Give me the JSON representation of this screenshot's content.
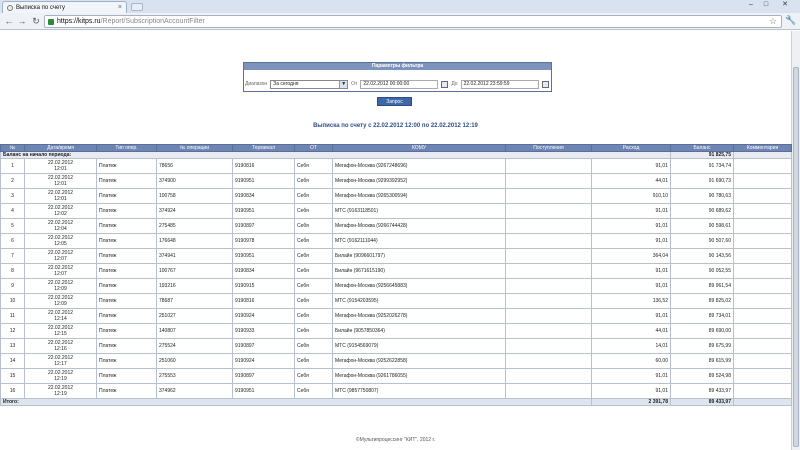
{
  "browser": {
    "tab_title": "Выписка по счету",
    "tab_close": "×",
    "win_min": "–",
    "win_max": "□",
    "win_close": "✕",
    "back_glyph": "←",
    "forward_glyph": "→",
    "reload_glyph": "↻",
    "url_host": "https://kitps.ru",
    "url_path": "/Report/SubscriptionAccountFilter",
    "star_glyph": "☆",
    "wrench_glyph": "🔧"
  },
  "filter": {
    "title": "Параметры фильтра",
    "range_label": "Диапазон",
    "range_value": "За сегодня",
    "from_label": "От",
    "from_value": "22.02.2012 00:00:00",
    "to_label": "До",
    "to_value": "22.02.2012 23:59:59",
    "submit_label": "Запрос"
  },
  "report": {
    "title": "Выписка по счету с 22.02.2012 12:00 по 22.02.2012 12:19"
  },
  "table": {
    "headers": [
      "№",
      "Дата/время",
      "Тип опер.",
      "№ операции",
      "Терминал",
      "ОТ",
      "КОМУ",
      "Поступления",
      "Расход",
      "Баланс",
      "Комментарии"
    ],
    "balance_label": "Баланс на начало периода:",
    "balance_value": "91 825,75",
    "rows": [
      {
        "no": "1",
        "date": "22.02.2012",
        "time": "12:01",
        "type": "Платеж",
        "op": "78656",
        "term": "9190816",
        "from": "Себя",
        "to": "Мегафон-Москва (9267248696)",
        "in": "",
        "out": "91,01",
        "bal": "91 734,74",
        "comment": ""
      },
      {
        "no": "2",
        "date": "22.02.2012",
        "time": "12:01",
        "type": "Платеж",
        "op": "374900",
        "term": "9190951",
        "from": "Себя",
        "to": "Мегафон-Москва (9299392952)",
        "in": "",
        "out": "44,01",
        "bal": "91 690,73",
        "comment": ""
      },
      {
        "no": "3",
        "date": "22.02.2012",
        "time": "12:01",
        "type": "Платеж",
        "op": "100758",
        "term": "9190834",
        "from": "Себя",
        "to": "Мегафон-Москва (9265300594)",
        "in": "",
        "out": "910,10",
        "bal": "90 780,63",
        "comment": ""
      },
      {
        "no": "4",
        "date": "22.02.2012",
        "time": "12:02",
        "type": "Платеж",
        "op": "374924",
        "term": "9190951",
        "from": "Себя",
        "to": "МТС (9163118501)",
        "in": "",
        "out": "91,01",
        "bal": "90 689,62",
        "comment": ""
      },
      {
        "no": "5",
        "date": "22.02.2012",
        "time": "12:04",
        "type": "Платеж",
        "op": "275485",
        "term": "9190897",
        "from": "Себя",
        "to": "Мегафон-Москва (9266744428)",
        "in": "",
        "out": "91,01",
        "bal": "90 598,61",
        "comment": ""
      },
      {
        "no": "6",
        "date": "22.02.2012",
        "time": "12:05",
        "type": "Платеж",
        "op": "176648",
        "term": "9190978",
        "from": "Себя",
        "to": "МТС (9162111044)",
        "in": "",
        "out": "91,01",
        "bal": "90 507,60",
        "comment": ""
      },
      {
        "no": "7",
        "date": "22.02.2012",
        "time": "12:07",
        "type": "Платеж",
        "op": "374941",
        "term": "9190951",
        "from": "Себя",
        "to": "Билайн (9096601797)",
        "in": "",
        "out": "364,04",
        "bal": "90 143,56",
        "comment": ""
      },
      {
        "no": "8",
        "date": "22.02.2012",
        "time": "12:07",
        "type": "Платеж",
        "op": "100767",
        "term": "9190834",
        "from": "Себя",
        "to": "Билайн (9671615190)",
        "in": "",
        "out": "91,01",
        "bal": "90 052,55",
        "comment": ""
      },
      {
        "no": "9",
        "date": "22.02.2012",
        "time": "12:09",
        "type": "Платеж",
        "op": "193216",
        "term": "9190915",
        "from": "Себя",
        "to": "Мегафон-Москва (9256645883)",
        "in": "",
        "out": "91,01",
        "bal": "89 961,54",
        "comment": ""
      },
      {
        "no": "10",
        "date": "22.02.2012",
        "time": "12:09",
        "type": "Платеж",
        "op": "78687",
        "term": "9190816",
        "from": "Себя",
        "to": "МТС (9154203595)",
        "in": "",
        "out": "136,52",
        "bal": "89 825,02",
        "comment": ""
      },
      {
        "no": "11",
        "date": "22.02.2012",
        "time": "12:14",
        "type": "Платеж",
        "op": "251027",
        "term": "9190924",
        "from": "Себя",
        "to": "Мегафон-Москва (9252026278)",
        "in": "",
        "out": "91,01",
        "bal": "89 734,01",
        "comment": ""
      },
      {
        "no": "12",
        "date": "22.02.2012",
        "time": "12:15",
        "type": "Платеж",
        "op": "140807",
        "term": "9190933",
        "from": "Себя",
        "to": "Билайн (9057850364)",
        "in": "",
        "out": "44,01",
        "bal": "89 690,00",
        "comment": ""
      },
      {
        "no": "13",
        "date": "22.02.2012",
        "time": "12:16",
        "type": "Платеж",
        "op": "275524",
        "term": "9190897",
        "from": "Себя",
        "to": "МТС (9154569079)",
        "in": "",
        "out": "14,01",
        "bal": "89 675,99",
        "comment": ""
      },
      {
        "no": "14",
        "date": "22.02.2012",
        "time": "12:17",
        "type": "Платеж",
        "op": "251060",
        "term": "9190924",
        "from": "Себя",
        "to": "Мегафон-Москва (9252622858)",
        "in": "",
        "out": "60,00",
        "bal": "89 615,99",
        "comment": ""
      },
      {
        "no": "15",
        "date": "22.02.2012",
        "time": "12:19",
        "type": "Платеж",
        "op": "275553",
        "term": "9190897",
        "from": "Себя",
        "to": "Мегафон-Москва (9261786055)",
        "in": "",
        "out": "91,01",
        "bal": "89 524,98",
        "comment": ""
      },
      {
        "no": "16",
        "date": "22.02.2012",
        "time": "12:19",
        "type": "Платеж",
        "op": "374962",
        "term": "9190951",
        "from": "Себя",
        "to": "МТС (9857750807)",
        "in": "",
        "out": "91,01",
        "bal": "89 433,97",
        "comment": ""
      }
    ],
    "totals_label": "Итого:",
    "totals_out": "2 391,78",
    "totals_bal": "89 433,97"
  },
  "footer": {
    "text": "©Мультипроцессинг \"КИТ\", 2012 г."
  }
}
